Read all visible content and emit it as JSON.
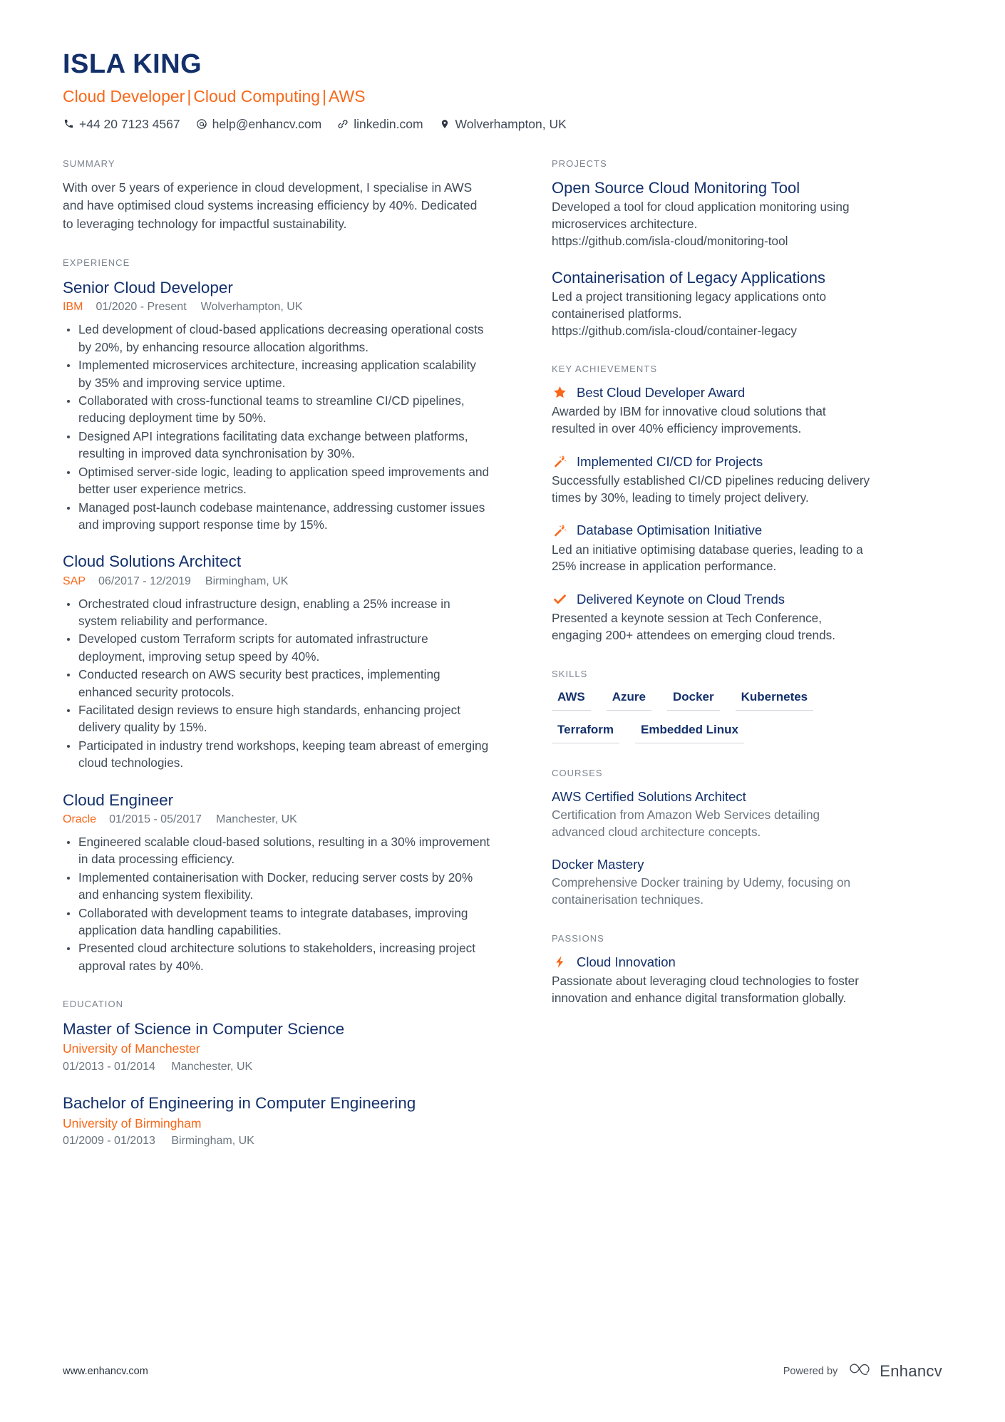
{
  "colors": {
    "navy": "#13306b",
    "orange": "#f8681a",
    "body_text": "#3f4a57",
    "muted": "#6b757f",
    "section_label": "#7b848f"
  },
  "header": {
    "name": "ISLA KING",
    "headline_parts": [
      "Cloud Developer",
      "Cloud Computing",
      "AWS"
    ],
    "headline_separator": "|",
    "contacts": [
      {
        "icon": "phone-icon",
        "text": "+44 20 7123 4567"
      },
      {
        "icon": "email-icon",
        "text": "help@enhancv.com"
      },
      {
        "icon": "link-icon",
        "text": "linkedin.com"
      },
      {
        "icon": "location-pin-icon",
        "text": "Wolverhampton, UK"
      }
    ]
  },
  "left": {
    "summary": {
      "title": "SUMMARY",
      "text": "With over 5 years of experience in cloud development, I specialise in AWS and have optimised cloud systems increasing efficiency by 40%. Dedicated to leveraging technology for impactful sustainability."
    },
    "experience": {
      "title": "EXPERIENCE",
      "entries": [
        {
          "role": "Senior Cloud Developer",
          "company": "IBM",
          "dates": "01/2020 - Present",
          "location": "Wolverhampton, UK",
          "bullets": [
            "Led development of cloud-based applications decreasing operational costs by 20%, by enhancing resource allocation algorithms.",
            "Implemented microservices architecture, increasing application scalability by 35% and improving service uptime.",
            "Collaborated with cross-functional teams to streamline CI/CD pipelines, reducing deployment time by 50%.",
            "Designed API integrations facilitating data exchange between platforms, resulting in improved data synchronisation by 30%.",
            "Optimised server-side logic, leading to application speed improvements and better user experience metrics.",
            "Managed post-launch codebase maintenance, addressing customer issues and improving support response time by 15%."
          ]
        },
        {
          "role": "Cloud Solutions Architect",
          "company": "SAP",
          "dates": "06/2017 - 12/2019",
          "location": "Birmingham, UK",
          "bullets": [
            "Orchestrated cloud infrastructure design, enabling a 25% increase in system reliability and performance.",
            "Developed custom Terraform scripts for automated infrastructure deployment, improving setup speed by 40%.",
            "Conducted research on AWS security best practices, implementing enhanced security protocols.",
            "Facilitated design reviews to ensure high standards, enhancing project delivery quality by 15%.",
            "Participated in industry trend workshops, keeping team abreast of emerging cloud technologies."
          ]
        },
        {
          "role": "Cloud Engineer",
          "company": "Oracle",
          "dates": "01/2015 - 05/2017",
          "location": "Manchester, UK",
          "bullets": [
            "Engineered scalable cloud-based solutions, resulting in a 30% improvement in data processing efficiency.",
            "Implemented containerisation with Docker, reducing server costs by 20% and enhancing system flexibility.",
            "Collaborated with development teams to integrate databases, improving application data handling capabilities.",
            "Presented cloud architecture solutions to stakeholders, increasing project approval rates by 40%."
          ]
        }
      ]
    },
    "education": {
      "title": "EDUCATION",
      "entries": [
        {
          "degree": "Master of Science in Computer Science",
          "school": "University of Manchester",
          "dates": "01/2013 - 01/2014",
          "location": "Manchester, UK"
        },
        {
          "degree": "Bachelor of Engineering in Computer Engineering",
          "school": "University of Birmingham",
          "dates": "01/2009 - 01/2013",
          "location": "Birmingham, UK"
        }
      ]
    }
  },
  "right": {
    "projects": {
      "title": "PROJECTS",
      "entries": [
        {
          "name": "Open Source Cloud Monitoring Tool",
          "description": "Developed a tool for cloud application monitoring using microservices architecture.",
          "url": "https://github.com/isla-cloud/monitoring-tool"
        },
        {
          "name": "Containerisation of Legacy Applications",
          "description": "Led a project transitioning legacy applications onto containerised platforms.",
          "url": "https://github.com/isla-cloud/container-legacy"
        }
      ]
    },
    "achievements": {
      "title": "KEY ACHIEVEMENTS",
      "entries": [
        {
          "icon": "star-icon",
          "title": "Best Cloud Developer Award",
          "description": "Awarded by IBM for innovative cloud solutions that resulted in over 40% efficiency improvements."
        },
        {
          "icon": "magic-wand-icon",
          "title": "Implemented CI/CD for Projects",
          "description": "Successfully established CI/CD pipelines reducing delivery times by 30%, leading to timely project delivery."
        },
        {
          "icon": "magic-wand-icon",
          "title": "Database Optimisation Initiative",
          "description": "Led an initiative optimising database queries, leading to a 25% increase in application performance."
        },
        {
          "icon": "checkmark-icon",
          "title": "Delivered Keynote on Cloud Trends",
          "description": "Presented a keynote session at Tech Conference, engaging 200+ attendees on emerging cloud trends."
        }
      ]
    },
    "skills": {
      "title": "SKILLS",
      "items": [
        "AWS",
        "Azure",
        "Docker",
        "Kubernetes",
        "Terraform",
        "Embedded Linux"
      ]
    },
    "courses": {
      "title": "COURSES",
      "entries": [
        {
          "name": "AWS Certified Solutions Architect",
          "description": "Certification from Amazon Web Services detailing advanced cloud architecture concepts."
        },
        {
          "name": "Docker Mastery",
          "description": "Comprehensive Docker training by Udemy, focusing on containerisation techniques."
        }
      ]
    },
    "passions": {
      "title": "PASSIONS",
      "entries": [
        {
          "icon": "lightning-bolt-icon",
          "title": "Cloud Innovation",
          "description": "Passionate about leveraging cloud technologies to foster innovation and enhance digital transformation globally."
        }
      ]
    }
  },
  "footer": {
    "url": "www.enhancv.com",
    "powered_by": "Powered by",
    "brand": "Enhancv"
  }
}
